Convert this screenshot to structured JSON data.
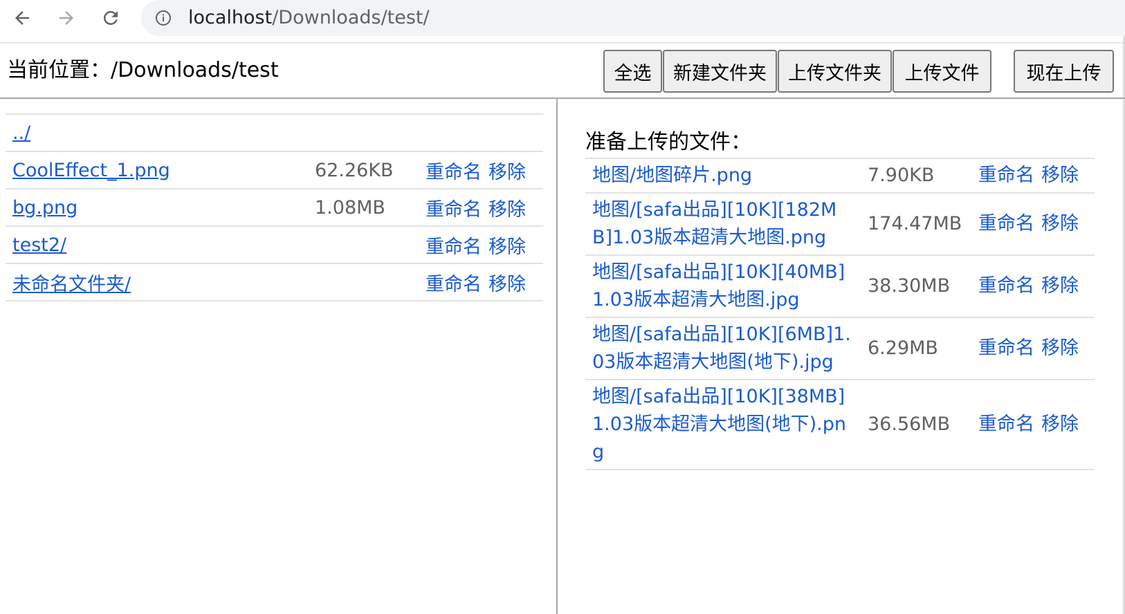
{
  "browser": {
    "url_host": "localhost",
    "url_path": "/Downloads/test/"
  },
  "header": {
    "location": "当前位置：/Downloads/test",
    "buttons": {
      "select_all": "全选",
      "new_folder": "新建文件夹",
      "upload_folder": "上传文件夹",
      "upload_file": "上传文件",
      "upload_now": "现在上传"
    }
  },
  "files": [
    {
      "name": "../",
      "size": "",
      "rename": "",
      "remove": ""
    },
    {
      "name": "CoolEffect_1.png",
      "size": "62.26KB",
      "rename": "重命名",
      "remove": "移除"
    },
    {
      "name": "bg.png",
      "size": "1.08MB",
      "rename": "重命名",
      "remove": "移除"
    },
    {
      "name": "test2/",
      "size": "",
      "rename": "重命名",
      "remove": "移除"
    },
    {
      "name": "未命名文件夹/",
      "size": "",
      "rename": "重命名",
      "remove": "移除"
    }
  ],
  "upload": {
    "title": "准备上传的文件：",
    "items": [
      {
        "name": "地图/地图碎片.png",
        "size": "7.90KB",
        "rename": "重命名",
        "remove": "移除"
      },
      {
        "name": "地图/[safa出品][10K][182MB]1.03版本超清大地图.png",
        "size": "174.47MB",
        "rename": "重命名",
        "remove": "移除"
      },
      {
        "name": "地图/[safa出品][10K][40MB]1.03版本超清大地图.jpg",
        "size": "38.30MB",
        "rename": "重命名",
        "remove": "移除"
      },
      {
        "name": "地图/[safa出品][10K][6MB]1.03版本超清大地图(地下).jpg",
        "size": "6.29MB",
        "rename": "重命名",
        "remove": "移除"
      },
      {
        "name": "地图/[safa出品][10K][38MB]1.03版本超清大地图(地下).png",
        "size": "36.56MB",
        "rename": "重命名",
        "remove": "移除"
      }
    ]
  },
  "colors": {
    "link": "#1a5bd0",
    "size_text": "#606060",
    "omnibox_bg": "#f1f3f4",
    "button_bg": "#efefef"
  },
  "icons": [
    "back-arrow-icon",
    "forward-arrow-icon",
    "reload-icon",
    "info-icon"
  ]
}
